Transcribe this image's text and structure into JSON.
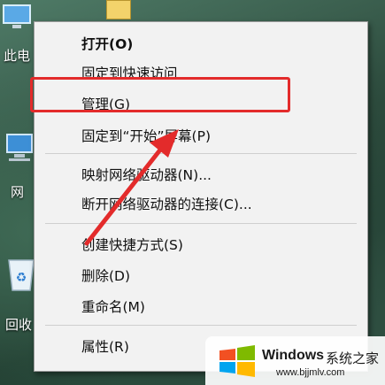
{
  "desktop": {
    "icons": [
      {
        "label": "此电",
        "icon": "this-pc-icon"
      },
      {
        "label": "网",
        "icon": "network-icon"
      },
      {
        "label": "回收",
        "icon": "recycle-bin-icon"
      }
    ]
  },
  "context_menu": {
    "items": [
      {
        "label": "打开(O)",
        "bold": true
      },
      {
        "label": "固定到快速访问"
      },
      {
        "label": "管理(G)",
        "highlighted": true
      },
      {
        "label": "固定到“开始”屏幕(P)"
      },
      {
        "label": "映射网络驱动器(N)..."
      },
      {
        "label": "断开网络驱动器的连接(C)..."
      },
      {
        "label": "创建快捷方式(S)"
      },
      {
        "label": "删除(D)"
      },
      {
        "label": "重命名(M)"
      },
      {
        "label": "属性(R)"
      }
    ]
  },
  "annotation": {
    "highlight_color": "#e32b2b",
    "arrow_color": "#e32b2b"
  },
  "watermark": {
    "brand": "Windows",
    "suffix": "系统之家",
    "url": "www.bjjmlv.com"
  }
}
